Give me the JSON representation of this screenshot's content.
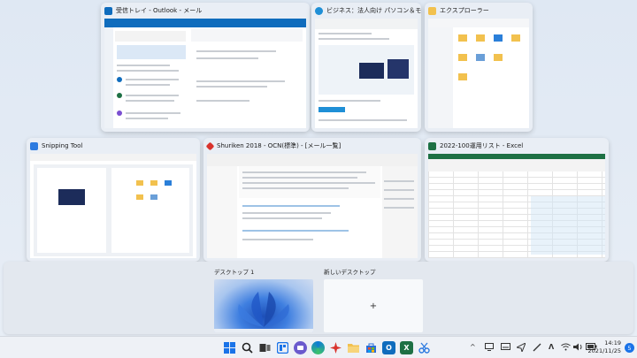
{
  "windows": [
    {
      "id": "outlook",
      "title": "受信トレイ - Outlook - メール",
      "accent": "#0f6cbd"
    },
    {
      "id": "edge",
      "title": "ビジネス：法人向け パソコン＆モニタ...",
      "accent": "#1f8fd6"
    },
    {
      "id": "explorer",
      "title": "エクスプローラー",
      "accent": "#f2c14e"
    },
    {
      "id": "snipping",
      "title": "Snipping Tool",
      "accent": "#2d7be0"
    },
    {
      "id": "shuriken",
      "title": "Shuriken 2018 - OCN(標準) - [メール一覧]",
      "accent": "#d9332d"
    },
    {
      "id": "excel",
      "title": "2022-100運用リスト - Excel",
      "accent": "#1d7044"
    }
  ],
  "desktops": {
    "desktop1_label": "デスクトップ 1",
    "new_desktop_label": "新しいデスクトップ",
    "add_symbol": "+"
  },
  "taskbar": {
    "clock_time": "14:19",
    "clock_date": "2021/11/25",
    "notification_count": "5",
    "tray_chevron": "^"
  }
}
